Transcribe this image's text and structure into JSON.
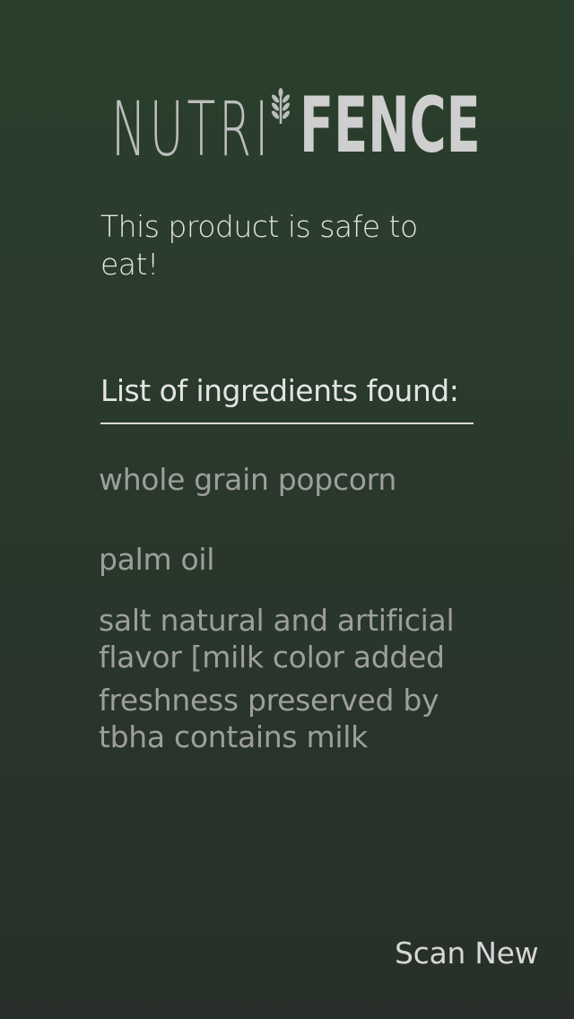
{
  "logo": {
    "light_text": "NUTRI",
    "bold_text": "FENCE",
    "icon": "wheat-icon"
  },
  "status": {
    "message": "This product is safe to eat!"
  },
  "ingredients": {
    "header": "List of ingredients found:",
    "items": [
      "whole grain popcorn",
      "palm oil",
      "salt natural and artificial flavor [milk color added",
      "freshness preserved by tbha contains milk"
    ]
  },
  "actions": {
    "scan_new_label": "Scan New"
  },
  "colors": {
    "background_top": "#2a3f2c",
    "background_bottom": "#282f2a",
    "text_primary": "#e4e4e4",
    "text_secondary": "#9e9e9e",
    "logo": "#cfcfcf"
  }
}
